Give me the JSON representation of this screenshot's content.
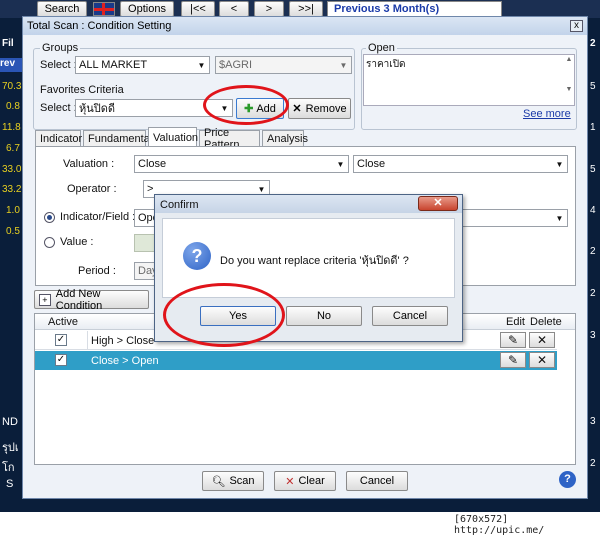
{
  "toolbar": {
    "search": "Search",
    "options": "Options",
    "first": "|<<",
    "prev": "<",
    "next": ">",
    "last": ">>|",
    "period_label": "Previous 3 Month(s)"
  },
  "background": {
    "left_values": [
      "70.3",
      "0.8",
      "11.8",
      "6.7",
      "33.0",
      "33.2",
      "1.0",
      "0.5"
    ],
    "left_labels": [
      "Fil",
      "rev"
    ],
    "left_bottom": [
      "ND",
      "รุปเ",
      "โก",
      "S"
    ],
    "right_values": [
      "2",
      "5",
      "1",
      "5",
      "4",
      "2",
      "2",
      "3",
      "3",
      "2"
    ]
  },
  "window": {
    "title": "Total Scan : Condition Setting",
    "close": "x",
    "groups": {
      "legend": "Groups",
      "select_label": "Select :",
      "market": "ALL MARKET",
      "sector": "$AGRI"
    },
    "favorites": {
      "legend": "Favorites Criteria",
      "select_label": "Select :",
      "value": "หุ้นปิดดี",
      "add": "Add",
      "remove": "Remove"
    },
    "open": {
      "legend": "Open",
      "text": "ราคาเปิด",
      "see_more": "See more"
    },
    "tabs": [
      "Indicator",
      "Fundamental",
      "Valuation",
      "Price Pattern",
      "Analysis"
    ],
    "valuation": {
      "valuation_label": "Valuation :",
      "valuation_value": "Close",
      "valuation_value2": "Close",
      "operator_label": "Operator :",
      "operator_value": ">",
      "indicator_label": "Indicator/Field :",
      "indicator_value": "Ope",
      "value_label": "Value :",
      "period_label": "Period :",
      "period_value": "Day"
    },
    "add_condition": "Add New Condition",
    "table": {
      "col_active": "Active",
      "col_edit": "Edit",
      "col_delete": "Delete",
      "rows": [
        {
          "checked": "✓",
          "text": "High > Close"
        },
        {
          "checked": "✓",
          "text": "Close > Open"
        }
      ]
    },
    "footer": {
      "scan": "Scan",
      "clear": "Clear",
      "cancel": "Cancel",
      "help": "?"
    }
  },
  "dialog": {
    "title": "Confirm",
    "message": "Do you want replace criteria 'หุ้นปิดดี' ?",
    "yes": "Yes",
    "no": "No",
    "cancel": "Cancel"
  },
  "watermark": "[670x572] http://upic.me/",
  "colors": {
    "frame_dark": "#0a1e3a",
    "window_title": "#c9d7ea",
    "selected_row": "#2f9ec7",
    "highlight_ring": "#e0141a",
    "dialog_blue": "#2e63c6"
  }
}
